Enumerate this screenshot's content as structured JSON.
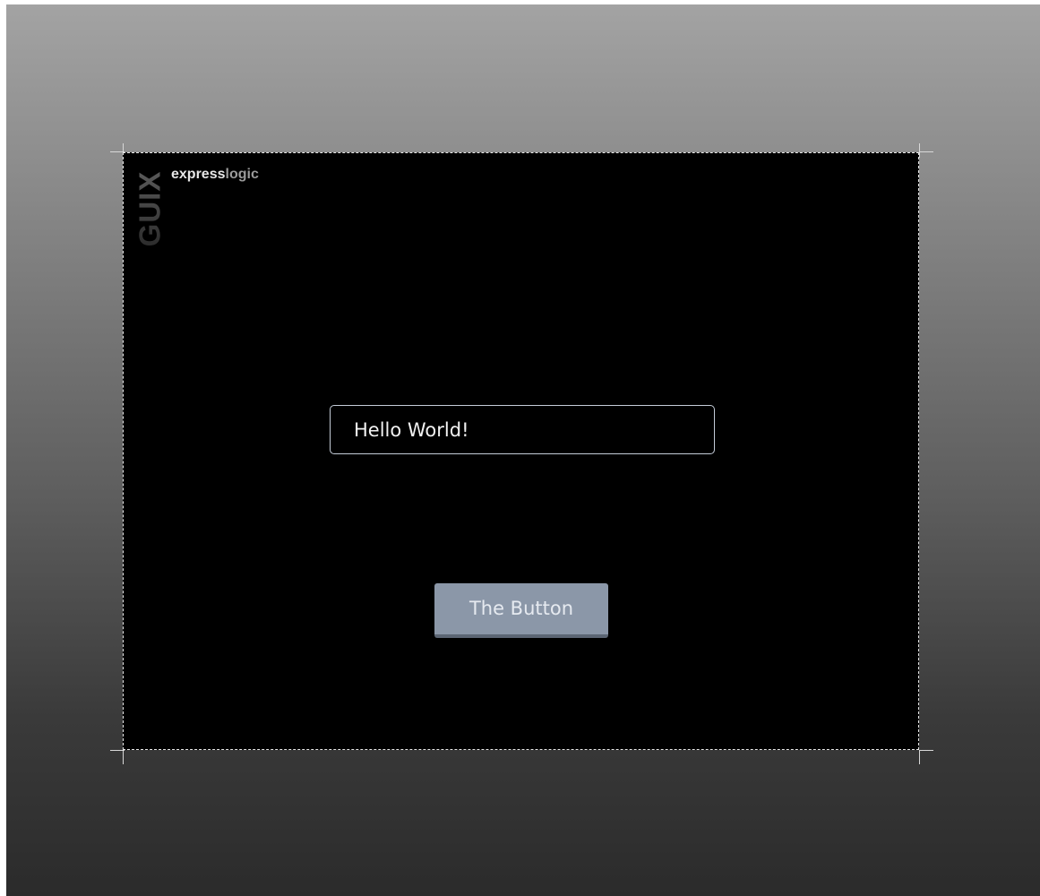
{
  "canvas": {
    "background": "#000000",
    "frame_border_color": "#e8e8e8"
  },
  "branding": {
    "guix_logo_text": "GUIX",
    "brand_part1": "express",
    "brand_part2": "logic"
  },
  "prompt": {
    "text": "Hello World!"
  },
  "button": {
    "label": "The Button",
    "color": "#8b97a8"
  }
}
